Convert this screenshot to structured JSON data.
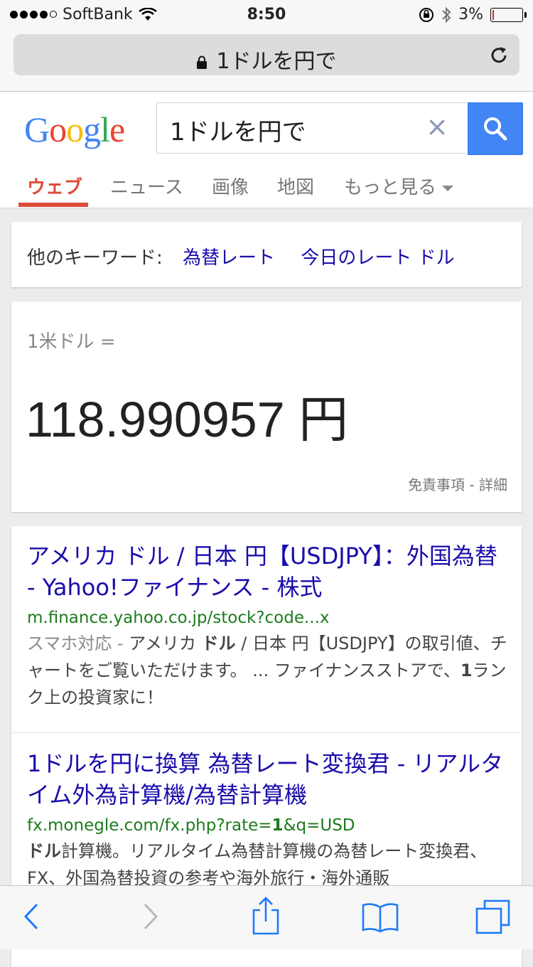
{
  "status": {
    "carrier": "SoftBank",
    "time": "8:50",
    "battery": "3%",
    "battery_level": 0.03,
    "signal_bars": 4
  },
  "address": {
    "title": "1ドルを円で"
  },
  "google": {
    "logo": "Google",
    "query": "1ドルを円で",
    "clear": "×",
    "tabs": [
      "ウェブ",
      "ニュース",
      "画像",
      "地図",
      "もっと見る"
    ]
  },
  "keywords": {
    "label": "他のキーワード:",
    "links": [
      "為替レート",
      "今日のレート ドル"
    ]
  },
  "fx": {
    "from": "1米ドル =",
    "value": "118.990957 円",
    "disclaimer": "免責事項 - 詳細"
  },
  "results": [
    {
      "title": "アメリカ ドル / 日本 円【USDJPY】：外国為替 - Yahoo!ファイナンス - 株式",
      "url": "m.finance.yahoo.co.jp/stock?code...x",
      "snippet_prefix": "スマホ対応 - ",
      "snippet_a": "アメリカ ",
      "snippet_b": "ドル",
      "snippet_c": " / 日本 円【USDJPY】の取引値、チャートをご覧いただけます。 ... ファイナンスストアで、",
      "snippet_d": "1",
      "snippet_e": "ランク上の投資家に！"
    },
    {
      "title": "1ドルを円に換算 為替レート変換君 - リアルタイム外為計算機/為替計算機",
      "url_a": "fx.monegle.com/fx.php?rate=",
      "url_b": "1",
      "url_c": "&q=USD",
      "snippet_a": "ドル",
      "snippet_b": "計算機。リアルタイム為替計算機の為替レート変換君、FX、外国為替投資の参考や海外旅行・海外通販"
    }
  ],
  "colors": {
    "link": "#1a0dab",
    "url": "#1e7b1e",
    "accent": "#dd4b39",
    "search_button": "#4285f4",
    "ios_blue": "#1d7bf6"
  }
}
